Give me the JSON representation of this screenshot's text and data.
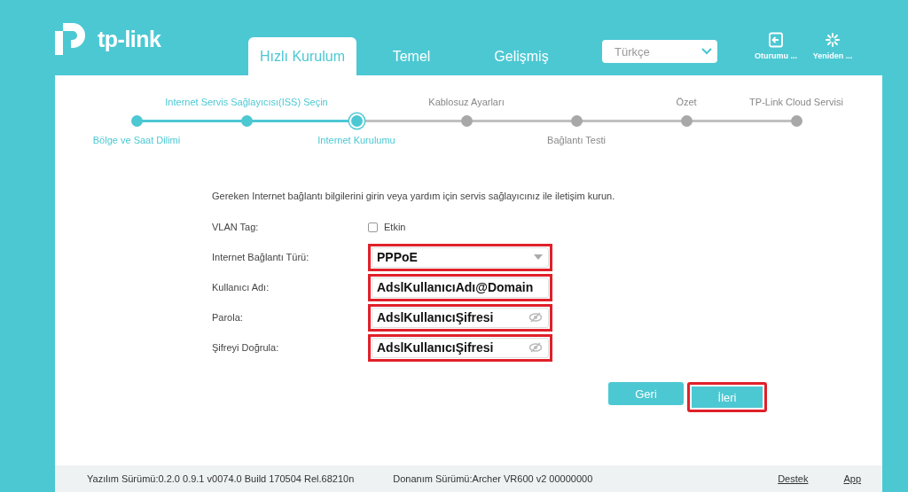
{
  "brand": {
    "name": "tp-link"
  },
  "nav_tabs": [
    {
      "label": "Hızlı Kurulum",
      "selected": true
    },
    {
      "label": "Temel",
      "selected": false
    },
    {
      "label": "Gelişmiş",
      "selected": false
    }
  ],
  "language_select": {
    "value": "Türkçe"
  },
  "header_actions": [
    {
      "kind": "logout",
      "label": "Oturumu ..."
    },
    {
      "kind": "reboot",
      "label": "Yeniden ..."
    }
  ],
  "wizard_steps": [
    {
      "label": "Bölge ve Saat Dilimi",
      "done": true,
      "selected": false,
      "label_above": false
    },
    {
      "label": "Internet Servis Sağlayıcısı(ISS) Seçin",
      "done": true,
      "selected": false,
      "label_above": true
    },
    {
      "label": "Internet Kurulumu",
      "done": true,
      "selected": true,
      "label_above": false
    },
    {
      "label": "Kablosuz Ayarları",
      "done": false,
      "selected": false,
      "label_above": true
    },
    {
      "label": "Bağlantı Testi",
      "done": false,
      "selected": false,
      "label_above": false
    },
    {
      "label": "Özet",
      "done": false,
      "selected": false,
      "label_above": true
    },
    {
      "label": "TP-Link Cloud Servisi",
      "done": false,
      "selected": false,
      "label_above": true
    }
  ],
  "intro": "Gereken Internet bağlantı bilgilerini girin veya yardım için servis sağlayıcınız ile iletişim kurun.",
  "form_rows": [
    {
      "kind": "checkbox",
      "label": "VLAN Tag:",
      "option": "Etkin",
      "checked": false
    },
    {
      "kind": "select",
      "label": "Internet Bağlantı Türü:",
      "value": "PPPoE",
      "highlighted": true
    },
    {
      "kind": "text",
      "label": "Kullanıcı Adı:",
      "value": "AdslKullanıcıAdı@Domain",
      "highlighted": true
    },
    {
      "kind": "password",
      "label": "Parola:",
      "value": "AdslKullanıcıŞifresi",
      "highlighted": true
    },
    {
      "kind": "password",
      "label": "Şifreyi Doğrula:",
      "value": "AdslKullanıcıŞifresi",
      "highlighted": true
    }
  ],
  "buttons": [
    {
      "label": "Geri",
      "highlighted": false
    },
    {
      "label": "İleri",
      "highlighted": true
    }
  ],
  "footer": {
    "software": "Yazılım Sürümü:0.2.0 0.9.1 v0074.0 Build 170504 Rel.68210n",
    "hardware": "Donanım Sürümü:Archer VR600 v2 00000000",
    "links": [
      "Destek",
      "App"
    ]
  }
}
